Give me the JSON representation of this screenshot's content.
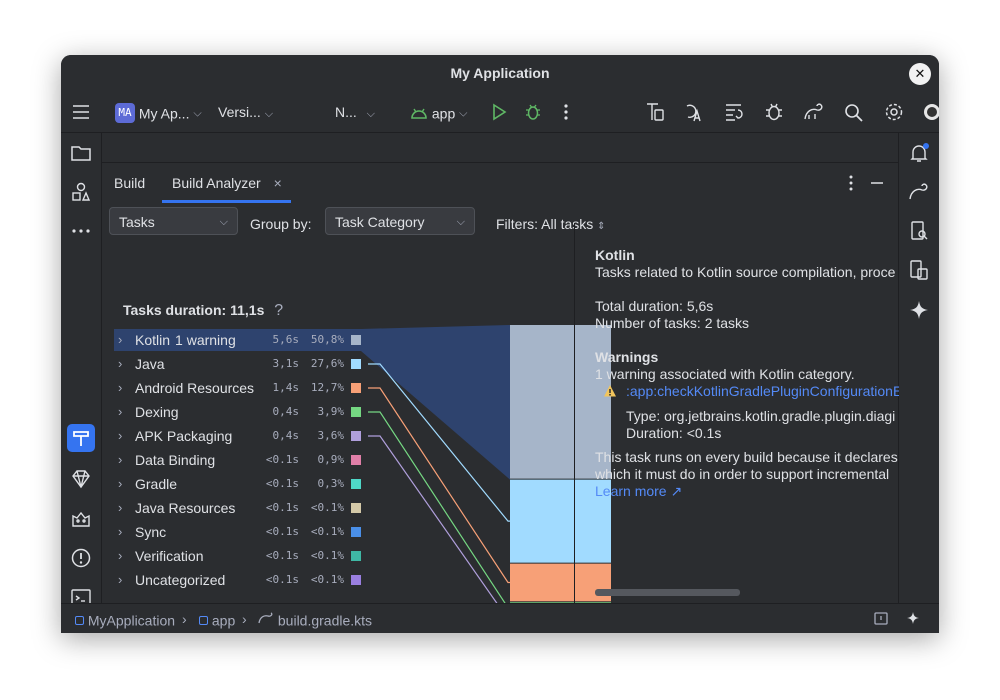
{
  "window": {
    "title": "My Application"
  },
  "toolbar": {
    "project_badge": "MA",
    "project_name": "My Ap...",
    "vcs_label": "Versi...",
    "device_label": "N...",
    "run_config": "app"
  },
  "tabs": {
    "build": "Build",
    "build_analyzer": "Build Analyzer",
    "close": "×"
  },
  "filters": {
    "view": "Tasks",
    "group_by_label": "Group by:",
    "group_by_value": "Task Category",
    "filters_label": "Filters: All tasks"
  },
  "summary": {
    "tasks_duration": "Tasks duration: 11,1s",
    "help": "?"
  },
  "categories": [
    {
      "name": "Kotlin",
      "badge": "1 warning",
      "duration": "5,6s",
      "percent": "50,8%",
      "color": "#a6b5c9",
      "share": 0.508
    },
    {
      "name": "Java",
      "duration": "3,1s",
      "percent": "27,6%",
      "color": "#a1dbff",
      "share": 0.276
    },
    {
      "name": "Android Resources",
      "duration": "1,4s",
      "percent": "12,7%",
      "color": "#f7a077",
      "share": 0.127
    },
    {
      "name": "Dexing",
      "duration": "0,4s",
      "percent": "3,9%",
      "color": "#75d782",
      "share": 0.039
    },
    {
      "name": "APK Packaging",
      "duration": "0,4s",
      "percent": "3,6%",
      "color": "#b09fdc",
      "share": 0.036
    },
    {
      "name": "Data Binding",
      "duration": "<0.1s",
      "percent": "0,9%",
      "color": "#e07fa8",
      "share": 0.009
    },
    {
      "name": "Gradle",
      "duration": "<0.1s",
      "percent": "0,3%",
      "color": "#4fd8c8",
      "share": 0.003
    },
    {
      "name": "Java Resources",
      "duration": "<0.1s",
      "percent": "<0.1%",
      "color": "#d4c9a8",
      "share": 0.001
    },
    {
      "name": "Sync",
      "duration": "<0.1s",
      "percent": "<0.1%",
      "color": "#4a8fe8",
      "share": 0.001
    },
    {
      "name": "Verification",
      "duration": "<0.1s",
      "percent": "<0.1%",
      "color": "#3fb8a5",
      "share": 0.001
    },
    {
      "name": "Uncategorized",
      "duration": "<0.1s",
      "percent": "<0.1%",
      "color": "#9a7fe0",
      "share": 0.001
    }
  ],
  "details": {
    "title": "Kotlin",
    "description": "Tasks related to Kotlin source compilation, proce",
    "total_duration": "Total duration: 5,6s",
    "task_count": "Number of tasks: 2 tasks",
    "warnings_title": "Warnings",
    "warnings_summary": "1 warning associated with Kotlin category.",
    "warning_task": ":app:checkKotlinGradlePluginConfigurationE",
    "warning_type": "Type: org.jetbrains.kotlin.gradle.plugin.diagi",
    "warning_duration": "Duration: <0.1s",
    "explanation_1": "This task runs on every build because it declares",
    "explanation_2": "which it must do in order to support incremental",
    "learn_more": "Learn more ↗"
  },
  "statusbar": {
    "project": "MyApplication",
    "module": "app",
    "file": "build.gradle.kts"
  },
  "colors": {
    "accent": "#3574f0",
    "link": "#548af7",
    "warning": "#f2c55c"
  }
}
